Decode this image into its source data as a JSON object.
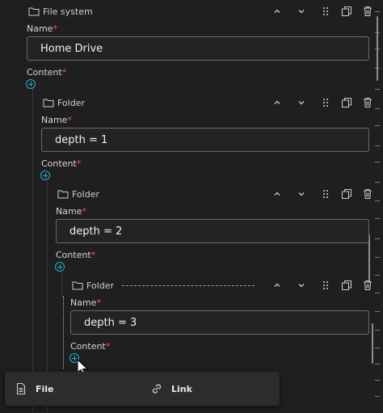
{
  "nodes": [
    {
      "type": "File system",
      "name_label": "Name",
      "name_value": "Home Drive",
      "content_label": "Content"
    },
    {
      "type": "Folder",
      "name_label": "Name",
      "name_value": "depth = 1",
      "content_label": "Content"
    },
    {
      "type": "Folder",
      "name_label": "Name",
      "name_value": "depth = 2",
      "content_label": "Content"
    },
    {
      "type": "Folder",
      "name_label": "Name",
      "name_value": "depth = 3",
      "content_label": "Content"
    }
  ],
  "required_mark": "*",
  "menu": {
    "items": [
      {
        "label": "File"
      },
      {
        "label": "Link"
      }
    ]
  },
  "icons": [
    "folder-icon",
    "chevron-up-icon",
    "chevron-down-icon",
    "drag-handle-icon",
    "copy-icon",
    "trash-icon",
    "add-icon",
    "file-icon",
    "link-icon"
  ],
  "colors": {
    "background": "#1f1f1f",
    "accent": "#1fb7c8",
    "required": "#ff4d4d"
  }
}
